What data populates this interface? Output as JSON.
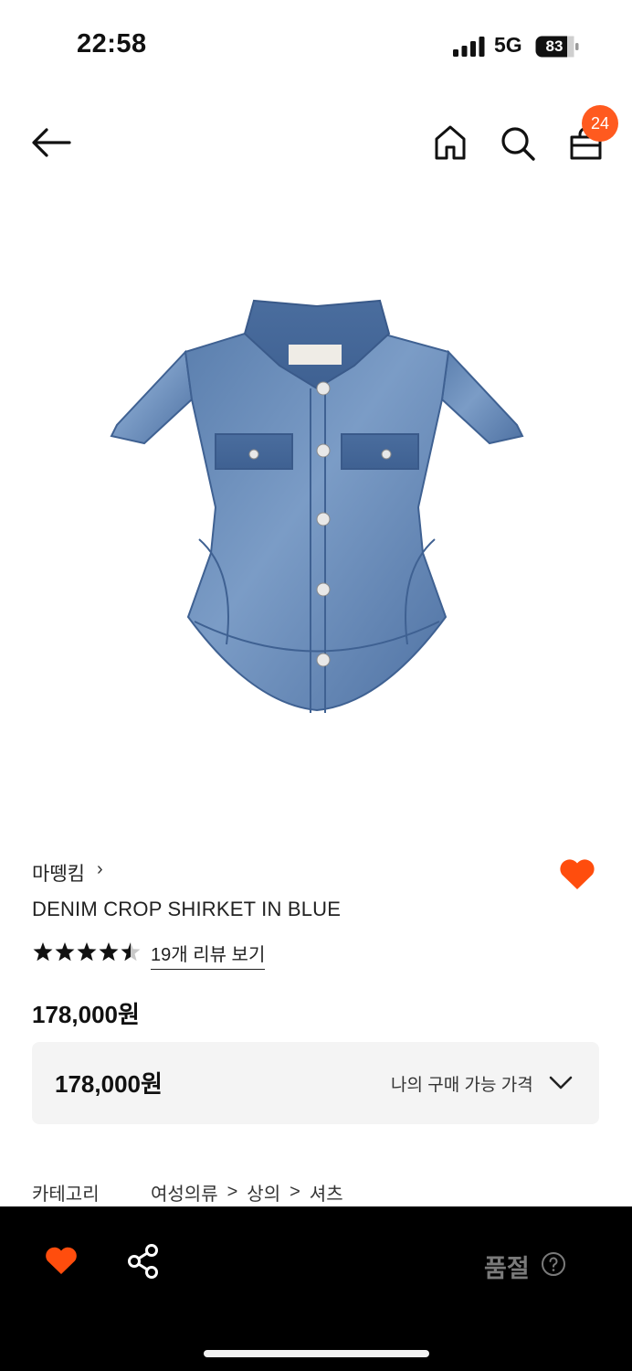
{
  "status_bar": {
    "time": "22:58",
    "network": "5G",
    "battery": "83"
  },
  "header": {
    "cart_count": "24"
  },
  "product": {
    "brand": "마뗑킴",
    "brand_chevron": "›",
    "name": "DENIM CROP SHIRKET IN BLUE",
    "rating": 4.5,
    "review_link": "19개 리뷰 보기",
    "price": "178,000원",
    "favorited": true
  },
  "price_box": {
    "price": "178,000원",
    "label": "나의 구매 가능 가격"
  },
  "category": {
    "label": "카테고리",
    "path": [
      "여성의류",
      "상의",
      "셔츠"
    ],
    "separator": ">"
  },
  "bottom_bar": {
    "status": "품절"
  },
  "colors": {
    "accent": "#ff5a1f",
    "heart": "#ff4d0d",
    "bar": "#000000"
  }
}
